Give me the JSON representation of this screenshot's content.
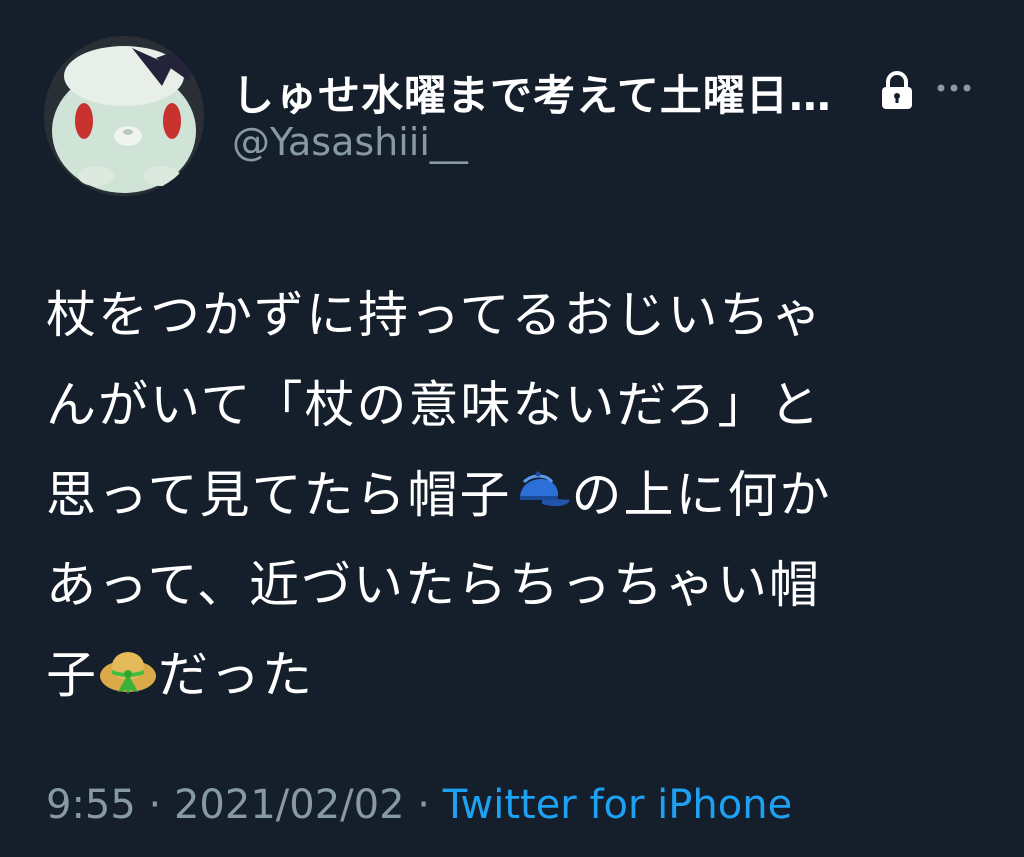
{
  "tweet": {
    "display_name": "しゅせ水曜まで考えて土曜日…",
    "handle": "@Yasashiii__",
    "body_lines": [
      [
        "杖をつかずに持ってるおじいちゃ"
      ],
      [
        "んがいて「杖の意味ないだろ」と"
      ],
      [
        "思って見てたら帽子",
        "の上に何か"
      ],
      [
        "あって、近づいたらちっちゃい帽"
      ],
      [
        "子",
        "だった"
      ]
    ],
    "time": "9:55",
    "separator": " · ",
    "date": "2021/02/02",
    "source": "Twitter for iPhone"
  },
  "icons": {
    "avatar": "plush-bunny-avatar",
    "lock": "lock-icon",
    "more": "more-dots-icon",
    "emoji_1": "blue-cap-emoji",
    "emoji_2": "straw-hat-emoji"
  },
  "colors": {
    "background": "#151f2c",
    "text": "#ffffff",
    "secondary": "#8899a6",
    "link": "#1da1f2"
  }
}
